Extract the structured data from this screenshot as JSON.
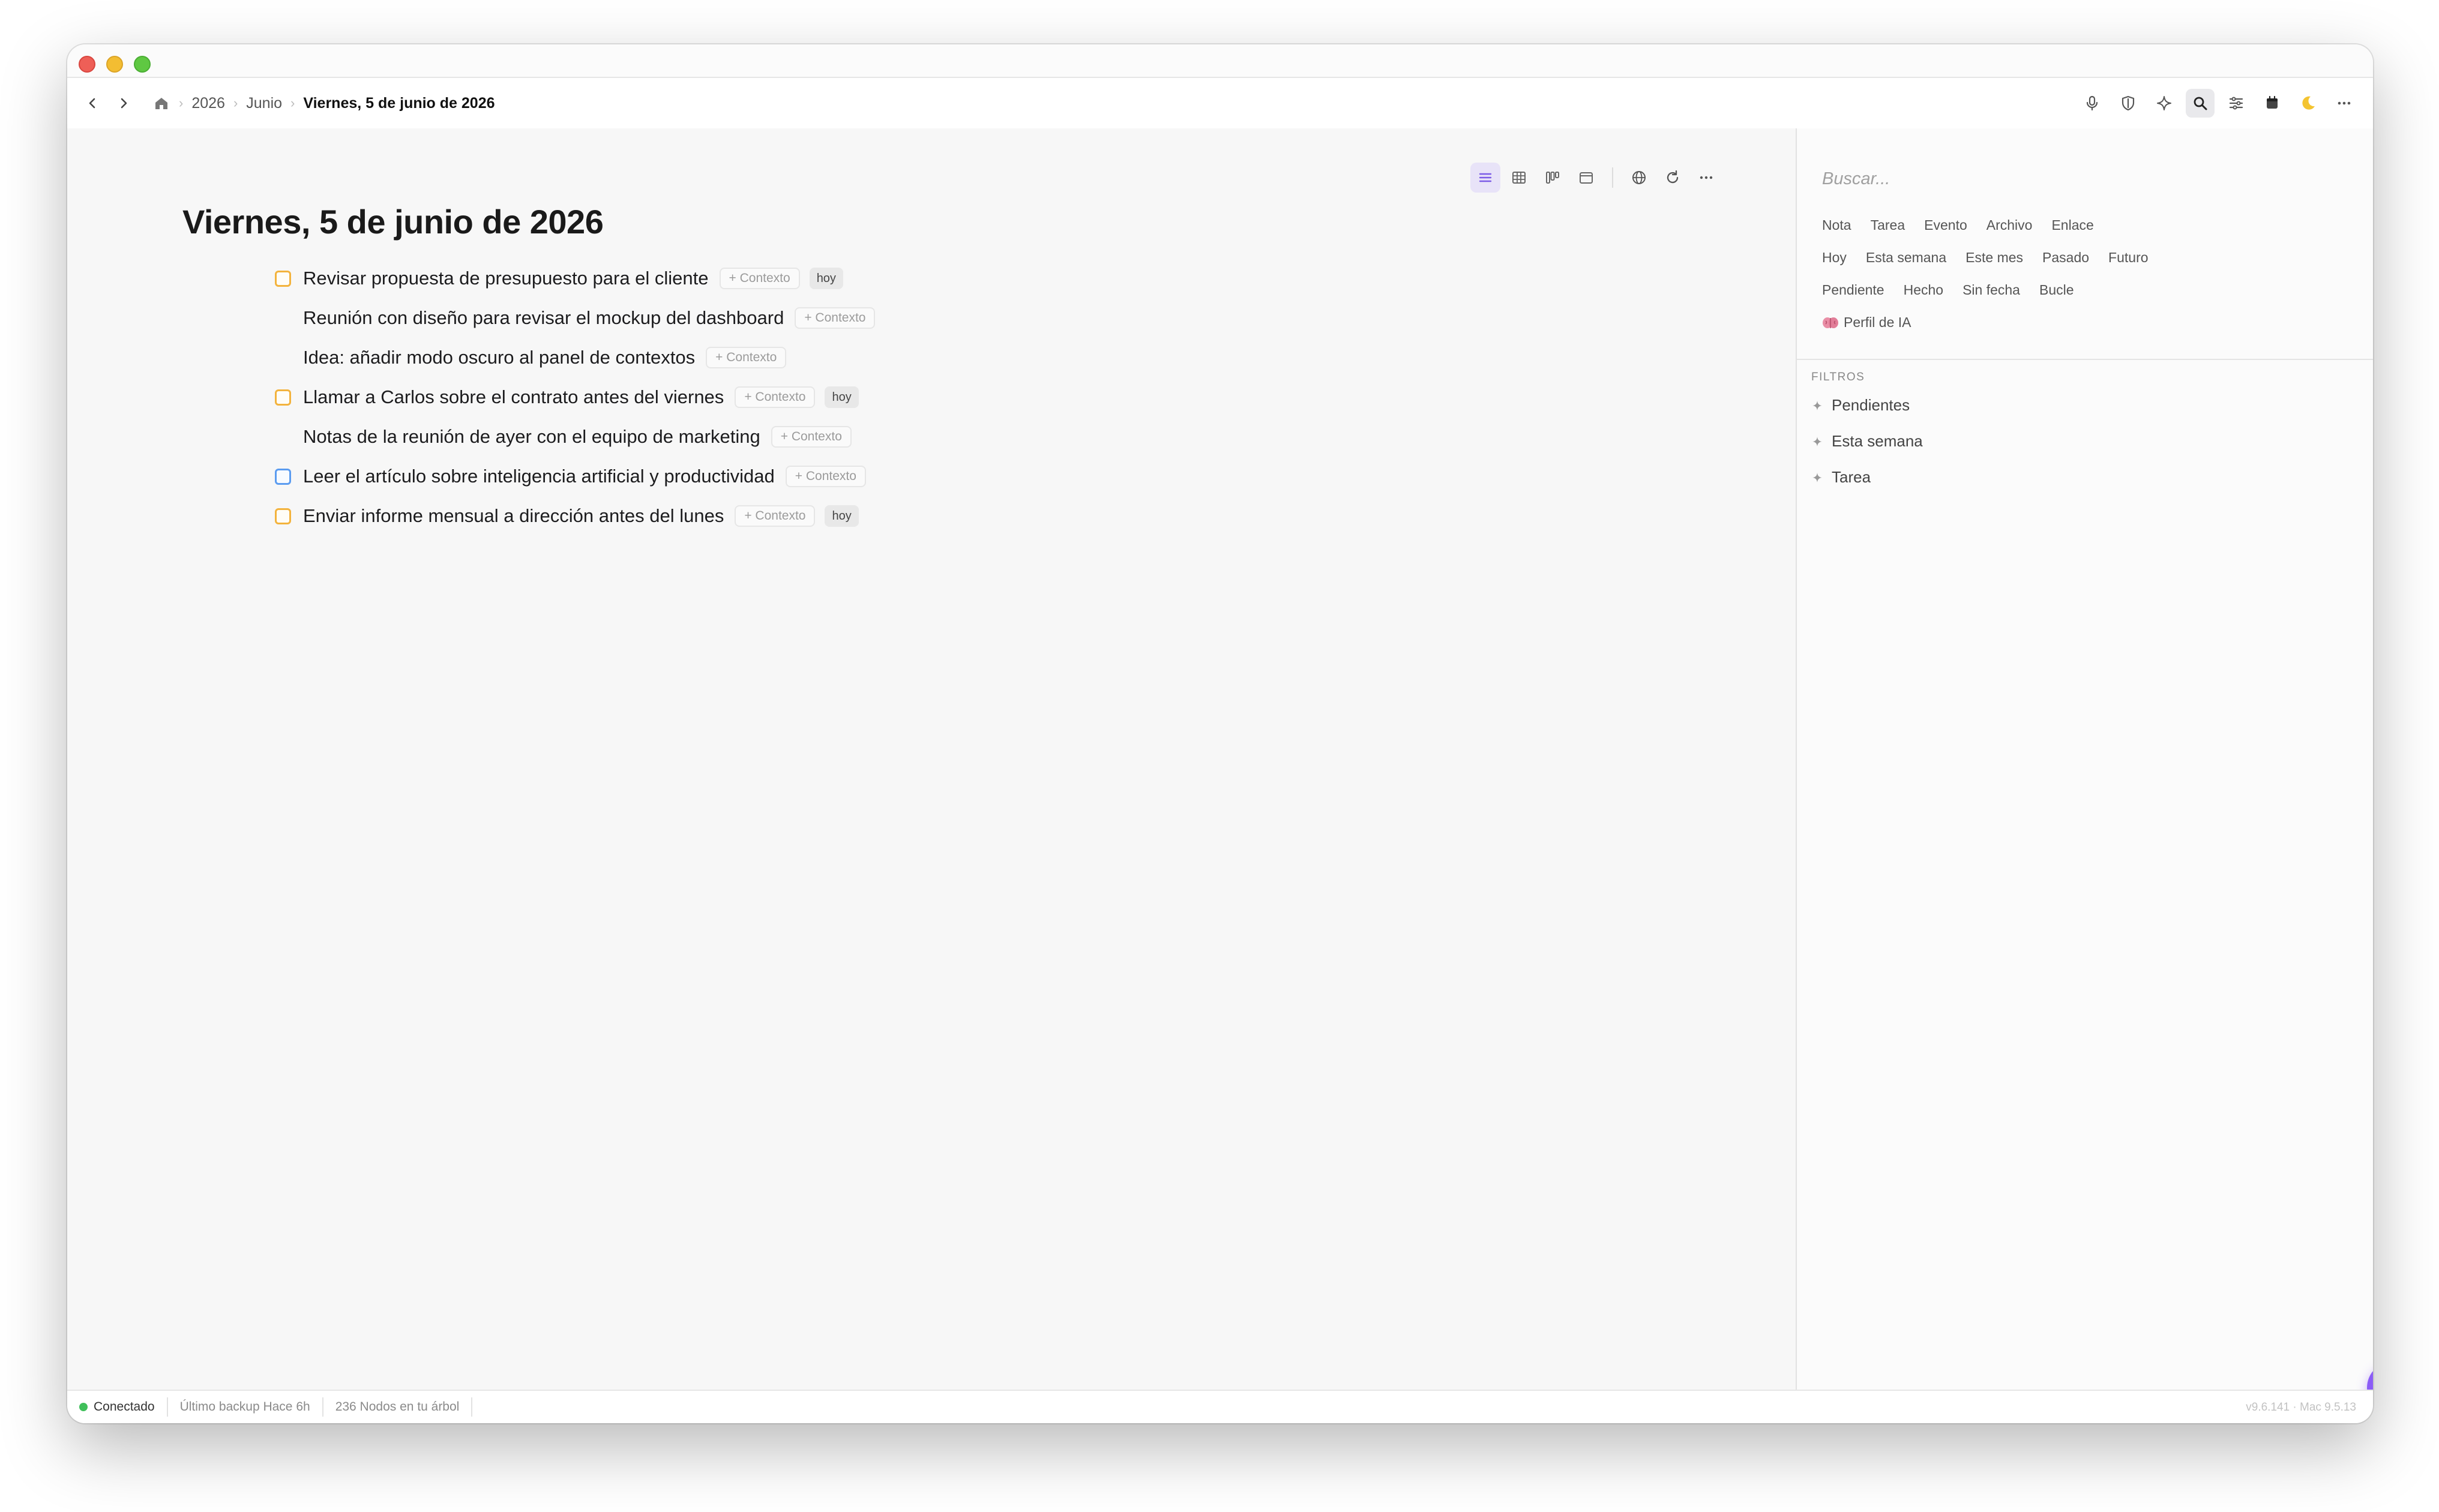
{
  "breadcrumb": {
    "year": "2026",
    "month": "Junio",
    "current": "Viernes, 5 de junio de 2026"
  },
  "toolbar_icons": [
    "microphone-icon",
    "shield-icon",
    "sparkle-icon",
    "search-icon",
    "sliders-icon",
    "calendar-icon",
    "moon-icon",
    "more-icon"
  ],
  "page": {
    "title": "Viernes, 5 de junio de 2026"
  },
  "view_tools": [
    "list-view-icon",
    "table-view-icon",
    "board-view-icon",
    "calendar-view-icon",
    "globe-icon",
    "refresh-icon",
    "more-icon"
  ],
  "items": [
    {
      "text": "Revisar propuesta de presupuesto para el cliente",
      "checkbox": "orange",
      "context": "+ Contexto",
      "date": "hoy"
    },
    {
      "text": "Reunión con diseño para revisar el mockup del dashboard",
      "checkbox": "none",
      "context": "+ Contexto",
      "date": ""
    },
    {
      "text": "Idea: añadir modo oscuro al panel de contextos",
      "checkbox": "none",
      "context": "+ Contexto",
      "date": ""
    },
    {
      "text": "Llamar a Carlos sobre el contrato antes del viernes",
      "checkbox": "orange",
      "context": "+ Contexto",
      "date": "hoy"
    },
    {
      "text": "Notas de la reunión de ayer con el equipo de marketing",
      "checkbox": "none",
      "context": "+ Contexto",
      "date": ""
    },
    {
      "text": "Leer el artículo sobre inteligencia artificial y productividad",
      "checkbox": "blue",
      "context": "+ Contexto",
      "date": ""
    },
    {
      "text": "Enviar informe mensual a dirección antes del lunes",
      "checkbox": "orange",
      "context": "+ Contexto",
      "date": "hoy"
    }
  ],
  "sidebar": {
    "search_placeholder": "Buscar...",
    "type_chips": [
      "Nota",
      "Tarea",
      "Evento",
      "Archivo",
      "Enlace"
    ],
    "time_chips": [
      "Hoy",
      "Esta semana",
      "Este mes",
      "Pasado",
      "Futuro"
    ],
    "status_chips": [
      "Pendiente",
      "Hecho",
      "Sin fecha",
      "Bucle"
    ],
    "ai_chip": "Perfil de IA",
    "filters_title": "FILTROS",
    "filters": [
      "Pendientes",
      "Esta semana",
      "Tarea"
    ]
  },
  "status": {
    "connection": "Conectado",
    "backup": "Último backup Hace 6h",
    "nodes": "236 Nodos en tu árbol",
    "version": "v9.6.141 · Mac 9.5.13"
  },
  "colors": {
    "accent": "#8b5cf6",
    "checkbox_orange": "#f3b33d",
    "checkbox_blue": "#5b9cf0",
    "connected": "#3fbf5a"
  }
}
